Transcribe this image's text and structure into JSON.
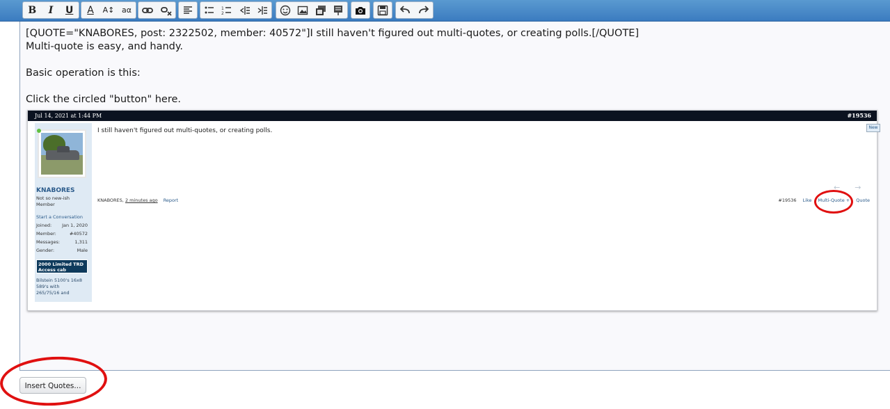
{
  "toolbar": {
    "buttons": [
      {
        "name": "bold-button",
        "glyph": "B"
      },
      {
        "name": "italic-button",
        "glyph": "I"
      },
      {
        "name": "underline-button",
        "glyph": "U"
      },
      {
        "name": "font-color-button",
        "glyph": "A"
      },
      {
        "name": "font-size-button",
        "glyph": "A↕"
      },
      {
        "name": "font-family-button",
        "glyph": "aα"
      },
      {
        "name": "link-button",
        "glyph": "🔗"
      },
      {
        "name": "unlink-button",
        "glyph": "⛓"
      },
      {
        "name": "align-button",
        "glyph": "≡"
      },
      {
        "name": "bullet-list-button",
        "glyph": "•"
      },
      {
        "name": "number-list-button",
        "glyph": "1."
      },
      {
        "name": "outdent-button",
        "glyph": "⇤"
      },
      {
        "name": "indent-button",
        "glyph": "⇥"
      },
      {
        "name": "smilie-button",
        "glyph": "☺"
      },
      {
        "name": "image-button",
        "glyph": "▣"
      },
      {
        "name": "media-button",
        "glyph": "⧉"
      },
      {
        "name": "code-button",
        "glyph": "☰"
      },
      {
        "name": "camera-button",
        "glyph": "📷"
      },
      {
        "name": "save-draft-button",
        "glyph": "💾"
      },
      {
        "name": "undo-button",
        "glyph": "↶"
      },
      {
        "name": "redo-button",
        "glyph": "↷"
      }
    ]
  },
  "editor": {
    "lines": [
      "[QUOTE=\"KNABORES, post: 2322502, member: 40572\"]I still haven't figured out multi-quotes, or creating polls.[/QUOTE]",
      "Multi-quote is easy, and handy.",
      "",
      "Basic operation is this:",
      "",
      "Click the circled \"button\" here."
    ]
  },
  "screenshot": {
    "date": "Jul 14, 2021 at 1:44 PM",
    "post_number": "#19536",
    "username": "KNABORES",
    "user_title_1": "Not so new-ish",
    "user_title_2": "Member",
    "start_conversation": "Start a Conversation",
    "stats": [
      {
        "label": "Joined:",
        "value": "Jan 1, 2020"
      },
      {
        "label": "Member:",
        "value": "#40572"
      },
      {
        "label": "Messages:",
        "value": "1,311"
      },
      {
        "label": "Gender:",
        "value": "Male"
      }
    ],
    "truck_1": "2000 Limited TRD",
    "truck_2": "Access cab",
    "sig_1": "Bilstein 5100's 16x8",
    "sig_2": "589's with",
    "sig_3": "265/75/16 and",
    "post_text": "I still haven't figured out multi-quotes, or creating polls.",
    "meta_user": "KNABORES,",
    "meta_time": "2 minutes ago",
    "meta_report": "Report",
    "action_num": "#19536",
    "action_like": "Like",
    "action_multiquote": "Multi-Quote +",
    "action_quote": "Quote",
    "new_tab": "New"
  },
  "insert_quotes_label": "Insert Quotes...",
  "colors": {
    "annotation": "#e01010",
    "toolbar": "#3b7cc0"
  }
}
